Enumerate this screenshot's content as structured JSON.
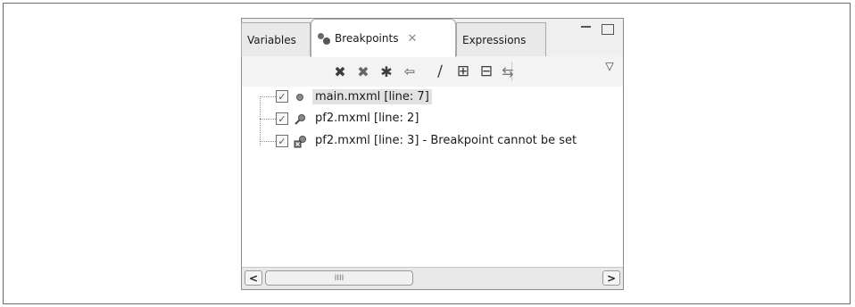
{
  "tabs": [
    {
      "label": "Variables"
    },
    {
      "label": "Breakpoints",
      "close_glyph": "✕"
    },
    {
      "label": "Expressions"
    }
  ],
  "window_controls": [
    "minimize-icon",
    "maximize-icon"
  ],
  "toolbar": {
    "buttons": [
      {
        "name": "remove-selected-breakpoints-icon",
        "glyph": "✖"
      },
      {
        "name": "remove-all-breakpoints-icon",
        "glyph": "✖"
      },
      {
        "name": "show-breakpoints-supported-icon",
        "glyph": "✱"
      },
      {
        "name": "go-to-file-icon",
        "glyph": "⇦"
      },
      {
        "name": "skip-all-breakpoints-icon",
        "glyph": "⧸"
      },
      {
        "name": "expand-all-icon",
        "glyph": "⊞"
      },
      {
        "name": "collapse-all-icon",
        "glyph": "⊟"
      },
      {
        "name": "link-with-debug-view-icon",
        "glyph": "⇆"
      },
      {
        "name": "view-menu-icon",
        "glyph": "▽"
      }
    ]
  },
  "breakpoints": [
    {
      "label": "main.mxml [line: 7]",
      "checked": true,
      "icon": "breakpoint-enabled-icon",
      "selected": true
    },
    {
      "label": "pf2.mxml [line: 2]",
      "checked": true,
      "icon": "breakpoint-search-icon",
      "selected": false
    },
    {
      "label": "pf2.mxml [line: 3] - Breakpoint cannot be set",
      "checked": true,
      "icon": "breakpoint-error-icon",
      "selected": false
    }
  ],
  "scrollbar": {
    "left_arrow": "<",
    "right_arrow": ">",
    "thumb_grip": "IIII"
  },
  "check_glyph": "✓"
}
